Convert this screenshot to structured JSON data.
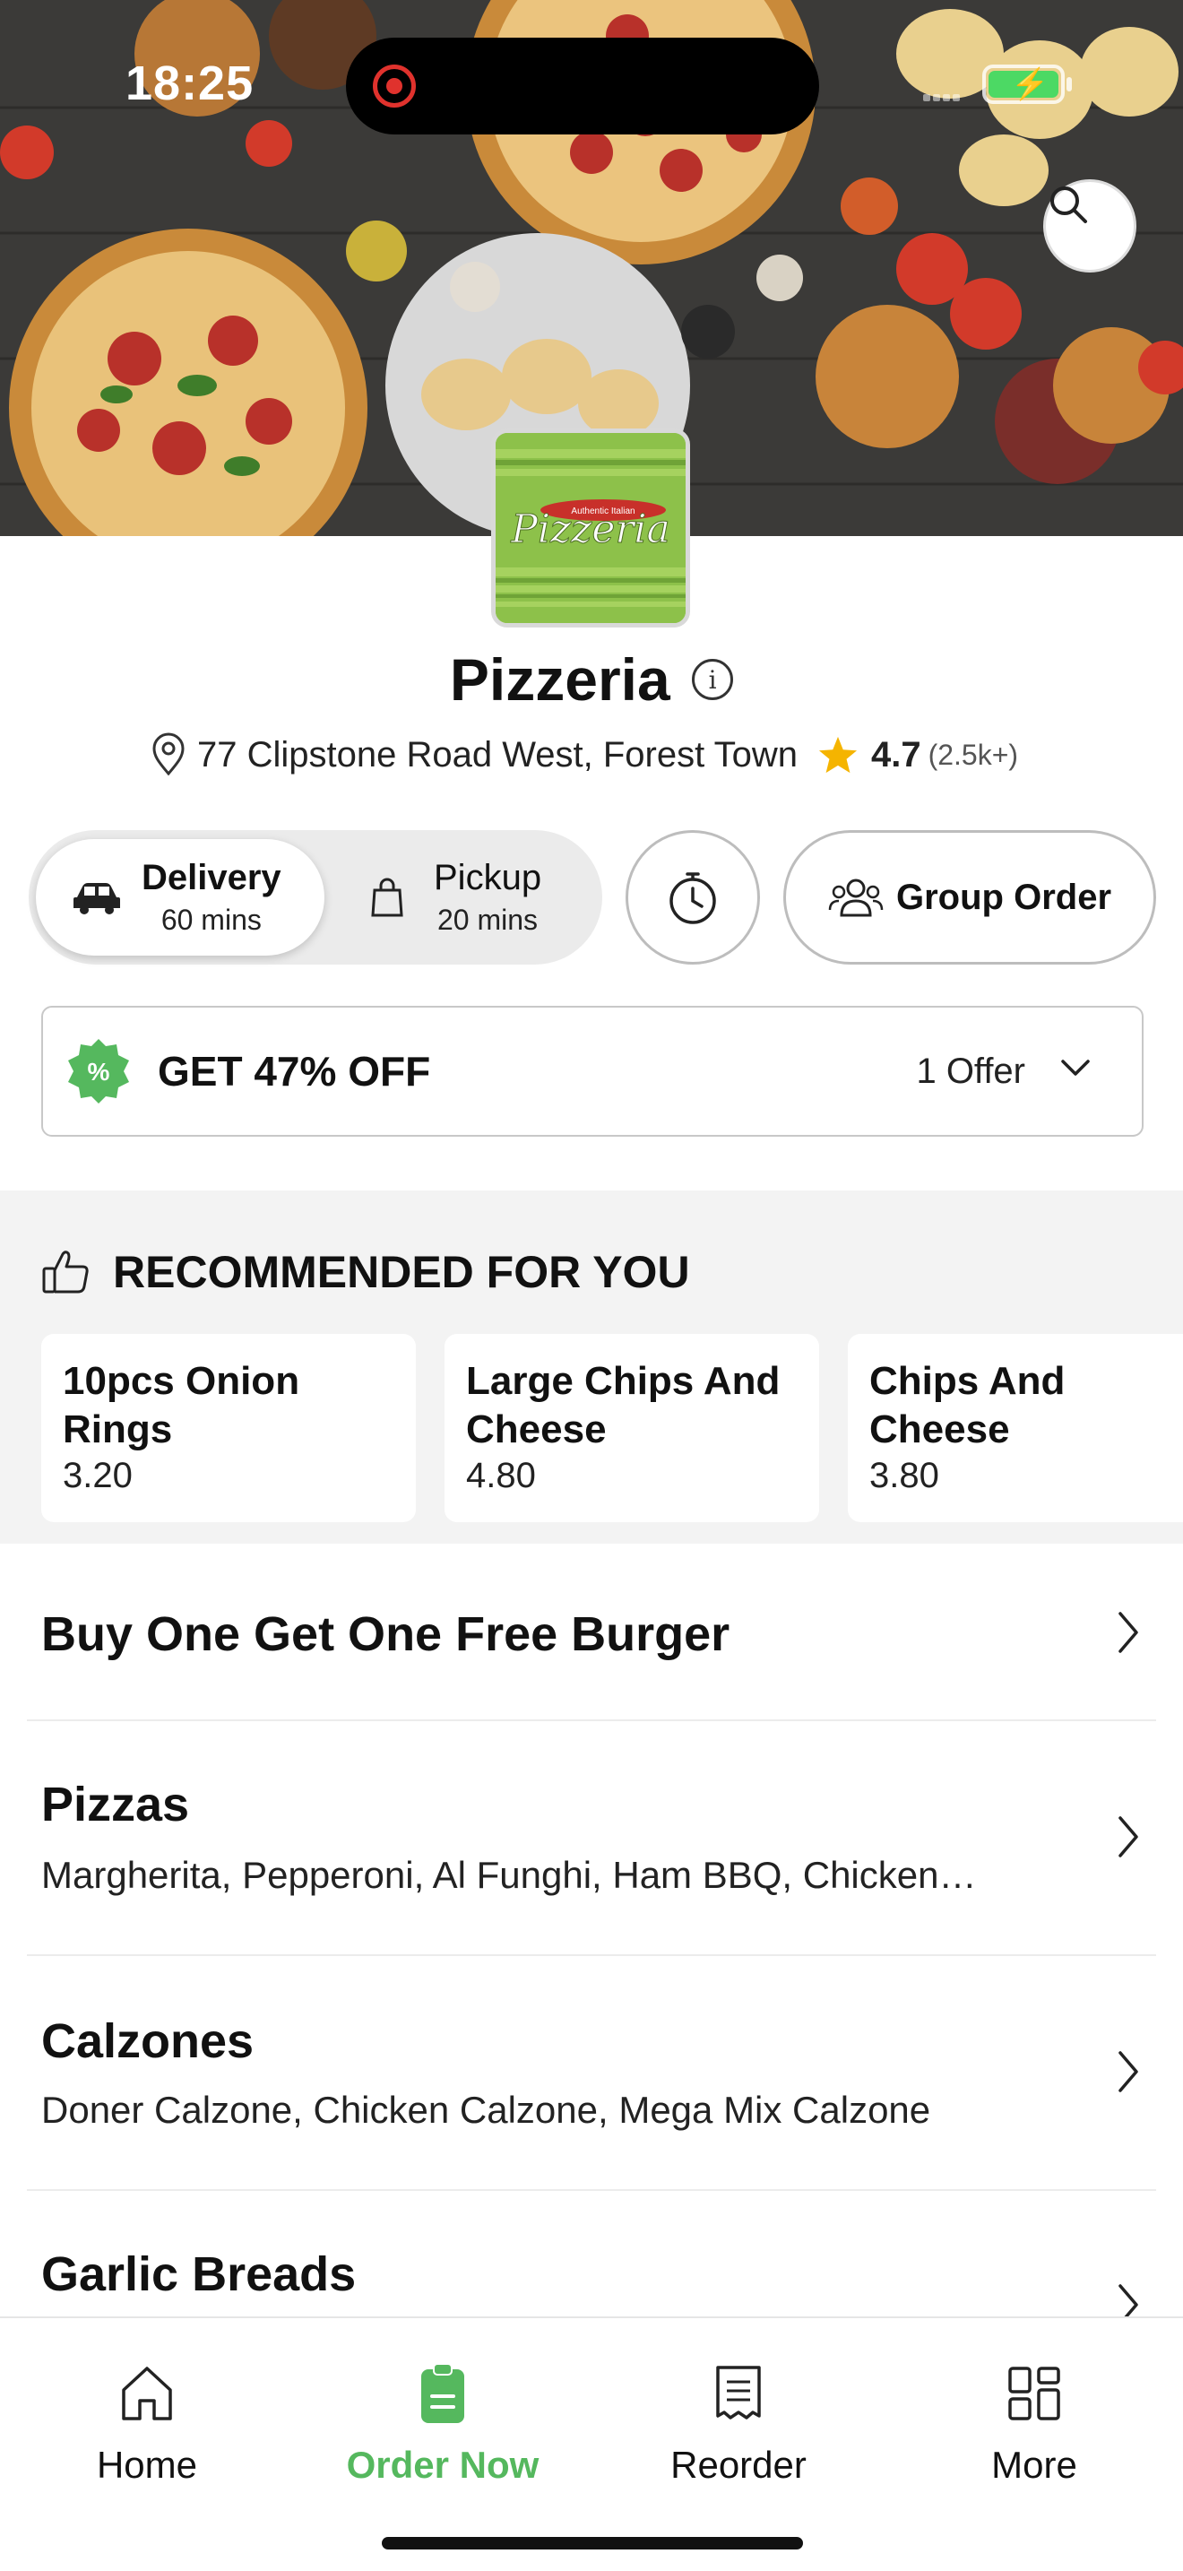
{
  "status_bar": {
    "time": "18:25"
  },
  "restaurant": {
    "name": "Pizzeria",
    "logo_text": "Pizzeria",
    "logo_tagline": "Authentic Italian",
    "address": "77 Clipstone Road West, Forest Town",
    "rating": "4.7",
    "rating_count": "(2.5k+)"
  },
  "modes": {
    "delivery": {
      "label": "Delivery",
      "time": "60 mins",
      "selected": true
    },
    "pickup": {
      "label": "Pickup",
      "time": "20 mins",
      "selected": false
    },
    "group_order_label": "Group Order"
  },
  "offer": {
    "title": "GET 47% OFF",
    "count": "1 Offer"
  },
  "recommended": {
    "heading": "RECOMMENDED FOR YOU",
    "items": [
      {
        "name": "10pcs Onion Rings",
        "price": "3.20"
      },
      {
        "name": "Large Chips And Cheese",
        "price": "4.80"
      },
      {
        "name": "Chips And Cheese",
        "price": "3.80"
      }
    ]
  },
  "categories": [
    {
      "title": "Buy One Get One Free Burger",
      "subtitle": ""
    },
    {
      "title": "Pizzas",
      "subtitle": "Margherita, Pepperoni, Al Funghi, Ham BBQ, Chicken…"
    },
    {
      "title": "Calzones",
      "subtitle": "Doner Calzone, Chicken Calzone, Mega Mix Calzone"
    },
    {
      "title": "Garlic Breads",
      "subtitle": ""
    }
  ],
  "tabbar": {
    "items": [
      {
        "label": "Home",
        "icon": "home-icon",
        "active": false
      },
      {
        "label": "Order Now",
        "icon": "order-icon",
        "active": true
      },
      {
        "label": "Reorder",
        "icon": "receipt-icon",
        "active": false
      },
      {
        "label": "More",
        "icon": "grid-icon",
        "active": false
      }
    ]
  },
  "colors": {
    "accent": "#55b85e",
    "rating_star": "#f5b400",
    "record": "#e0322d",
    "logo_green": "#8dc14a"
  }
}
